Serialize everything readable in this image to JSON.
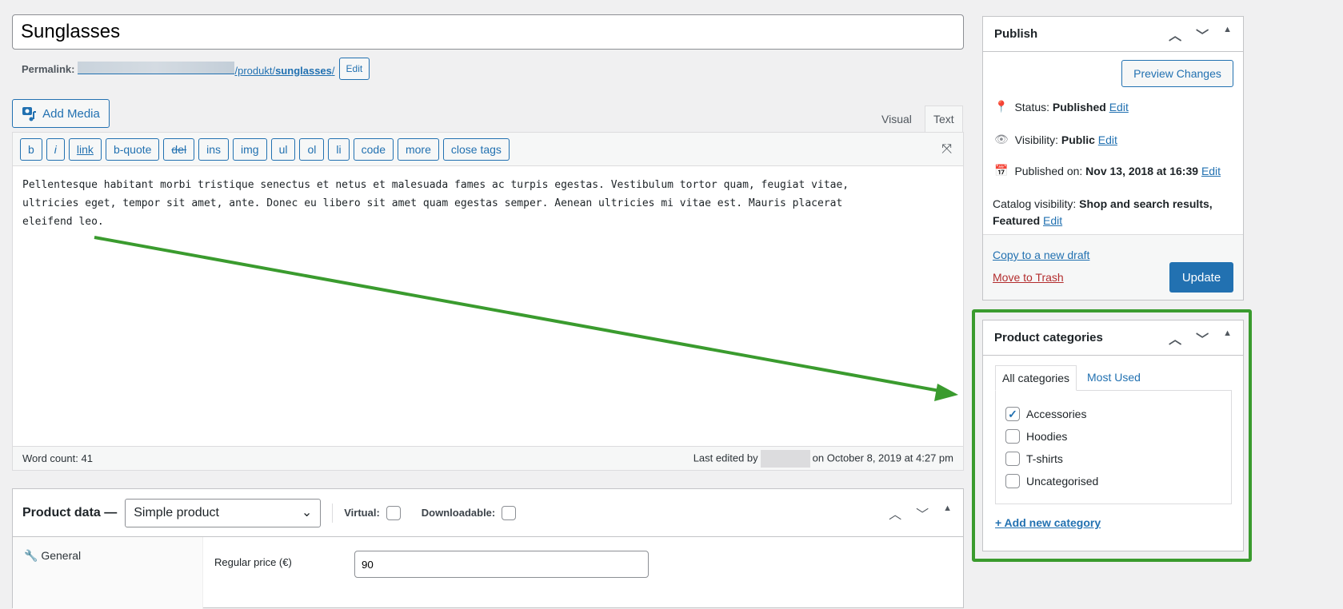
{
  "post_title": "Sunglasses",
  "permalink": {
    "label": "Permalink:",
    "path": "/produkt/",
    "slug": "sunglasses",
    "trail": "/",
    "edit": "Edit"
  },
  "add_media": "Add Media",
  "editor_tabs": [
    "Visual",
    "Text"
  ],
  "quicktags": [
    "b",
    "i",
    "link",
    "b-quote",
    "del",
    "ins",
    "img",
    "ul",
    "ol",
    "li",
    "code",
    "more",
    "close tags"
  ],
  "content": "Pellentesque habitant morbi tristique senectus et netus et malesuada fames ac turpis egestas. Vestibulum tortor quam, feugiat vitae,\nultricies eget, tempor sit amet, ante. Donec eu libero sit amet quam egestas semper. Aenean ultricies mi vitae est. Mauris placerat\neleifend leo.",
  "status_bar": {
    "word_count": "Word count: 41",
    "last_edited_prefix": "Last edited by",
    "last_edited_suffix": "on October 8, 2019 at 4:27 pm"
  },
  "product_data": {
    "label": "Product data —",
    "type": "Simple product",
    "virtual": "Virtual:",
    "downloadable": "Downloadable:",
    "tab_general": "General",
    "regular_price_label": "Regular price (€)",
    "regular_price": "90"
  },
  "publish": {
    "title": "Publish",
    "preview": "Preview Changes",
    "status_label": "Status:",
    "status": "Published",
    "visibility_label": "Visibility:",
    "visibility": "Public",
    "published_label": "Published on:",
    "published": "Nov 13, 2018 at 16:39",
    "catalog_label": "Catalog visibility:",
    "catalog": "Shop and search results,",
    "catalog2": "Featured",
    "edit": "Edit",
    "copy": "Copy to a new draft",
    "trash": "Move to Trash",
    "update": "Update"
  },
  "categories": {
    "title": "Product categories",
    "tabs": [
      "All categories",
      "Most Used"
    ],
    "items": [
      {
        "label": "Accessories",
        "checked": true
      },
      {
        "label": "Hoodies",
        "checked": false
      },
      {
        "label": "T-shirts",
        "checked": false
      },
      {
        "label": "Uncategorised",
        "checked": false
      }
    ],
    "add": "+ Add new category"
  },
  "colors": {
    "accent": "#2271b1",
    "highlight": "#3a9b2e",
    "trash": "#b32d2e"
  }
}
